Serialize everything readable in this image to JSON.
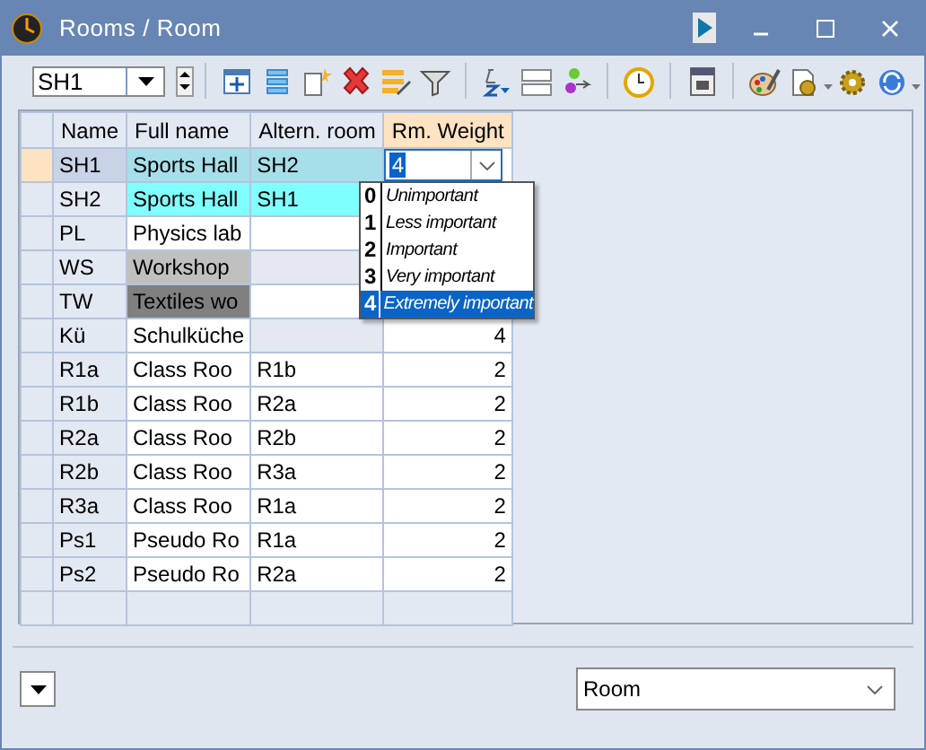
{
  "window": {
    "title": "Rooms / Room"
  },
  "toolbar": {
    "combo": {
      "value": "SH1"
    }
  },
  "table": {
    "columns": [
      {
        "label": "Name",
        "highlighted": false
      },
      {
        "label": "Full name",
        "highlighted": false
      },
      {
        "label": "Altern. room",
        "highlighted": false
      },
      {
        "label": "Rm. Weight",
        "highlighted": true
      }
    ],
    "rows": [
      {
        "selected": true,
        "cells": [
          {
            "text": "SH1"
          },
          {
            "text": "Sports Hall",
            "color": "#a6dfe9"
          },
          {
            "text": "SH2",
            "color": "#a6dfe9"
          }
        ],
        "weight_editor": {
          "value": "4",
          "options": [
            {
              "digit": "0",
              "label": "Unimportant",
              "selected": false
            },
            {
              "digit": "1",
              "label": "Less important",
              "selected": false
            },
            {
              "digit": "2",
              "label": "Important",
              "selected": false
            },
            {
              "digit": "3",
              "label": "Very important",
              "selected": false
            },
            {
              "digit": "4",
              "label": "Extremely important",
              "selected": true
            }
          ]
        }
      },
      {
        "selected": false,
        "cells": [
          {
            "text": "SH2"
          },
          {
            "text": "Sports Hall",
            "color": "#80ffff"
          },
          {
            "text": "SH1",
            "color": "#80ffff"
          }
        ]
      },
      {
        "selected": false,
        "cells": [
          {
            "text": "PL"
          },
          {
            "text": "Physics lab"
          },
          {}
        ]
      },
      {
        "selected": false,
        "cells": [
          {
            "text": "WS"
          },
          {
            "text": "Workshop",
            "color": "#c0c0c0"
          },
          {
            "color": "#e3e8f1"
          }
        ]
      },
      {
        "selected": false,
        "cells": [
          {
            "text": "TW"
          },
          {
            "text": "Textiles wo",
            "color": "#808080"
          },
          {}
        ]
      },
      {
        "selected": false,
        "cells": [
          {
            "text": "Kü"
          },
          {
            "text": "Schulküche"
          },
          {
            "color": "#e3e8f1"
          }
        ],
        "weight": "4"
      },
      {
        "selected": false,
        "cells": [
          {
            "text": "R1a"
          },
          {
            "text": "Class Roo"
          },
          {
            "text": "R1b"
          }
        ],
        "weight": "2"
      },
      {
        "selected": false,
        "cells": [
          {
            "text": "R1b"
          },
          {
            "text": "Class Roo"
          },
          {
            "text": "R2a"
          }
        ],
        "weight": "2"
      },
      {
        "selected": false,
        "cells": [
          {
            "text": "R2a"
          },
          {
            "text": "Class Roo"
          },
          {
            "text": "R2b"
          }
        ],
        "weight": "2"
      },
      {
        "selected": false,
        "cells": [
          {
            "text": "R2b"
          },
          {
            "text": "Class Roo"
          },
          {
            "text": "R3a"
          }
        ],
        "weight": "2"
      },
      {
        "selected": false,
        "cells": [
          {
            "text": "R3a"
          },
          {
            "text": "Class Roo"
          },
          {
            "text": "R1a"
          }
        ],
        "weight": "2"
      },
      {
        "selected": false,
        "cells": [
          {
            "text": "Ps1"
          },
          {
            "text": "Pseudo Ro"
          },
          {
            "text": "R1a"
          }
        ],
        "weight": "2"
      },
      {
        "selected": false,
        "cells": [
          {
            "text": "Ps2"
          },
          {
            "text": "Pseudo Ro"
          },
          {
            "text": "R2a"
          }
        ],
        "weight": "2"
      }
    ]
  },
  "footer": {
    "view_combo": {
      "value": "Room"
    }
  }
}
